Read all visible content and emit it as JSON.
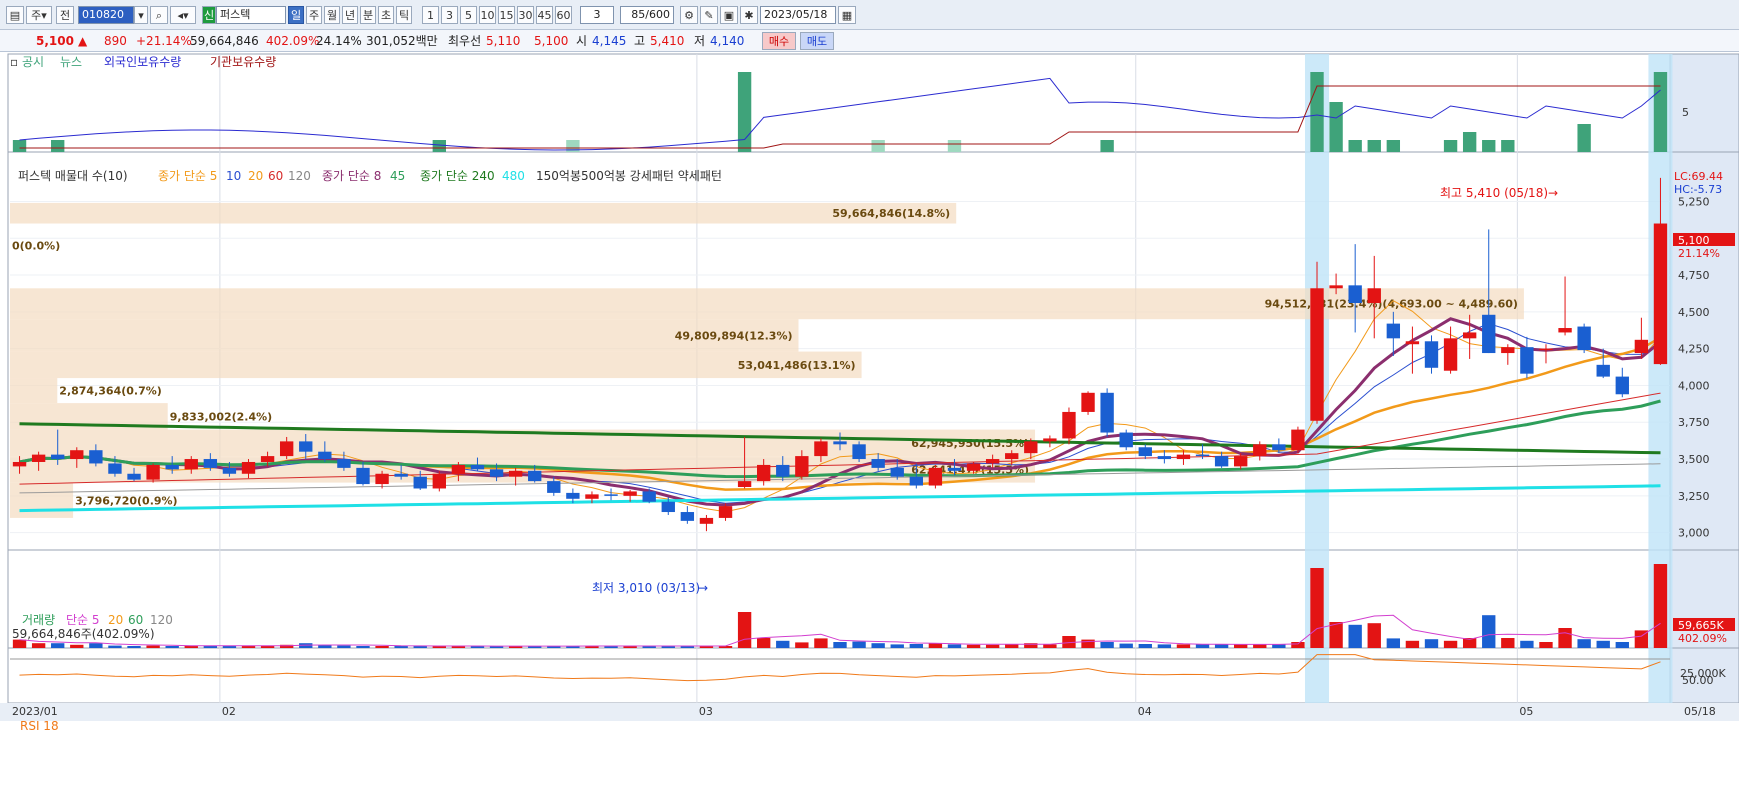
{
  "toolbar": {
    "period_btn": "주",
    "prev_btn": "전",
    "code": "010820",
    "stock_name": "퍼스텍",
    "new_badge": "신",
    "timeframes": [
      "일",
      "주",
      "월",
      "년",
      "분",
      "초",
      "틱"
    ],
    "numbers": [
      "1",
      "3",
      "5",
      "10",
      "15",
      "30",
      "45",
      "60"
    ],
    "select_val": "3",
    "count": "85/600",
    "date": "2023/05/18"
  },
  "quote": {
    "price": "5,100",
    "change": "890",
    "change_pct": "+21.14%",
    "volume": "59,664,846",
    "vol_ratio": "402.09%",
    "turnover": "24.14%",
    "amount": "301,052백만",
    "best_label": "최우선",
    "best_ask": "5,110",
    "best_bid": "5,100",
    "open_label": "시",
    "open": "4,145",
    "high_label": "고",
    "high": "5,410",
    "low_label": "저",
    "low": "4,140",
    "buy_btn": "매수",
    "sell_btn": "매도"
  },
  "panels": {
    "top_legend": [
      "공시",
      "뉴스",
      "외국인보유수량",
      "기관보유수량"
    ],
    "top_axis": "5",
    "price_legend": "퍼스텍 매물대 수(10)",
    "ma_group1": [
      "종가 단순 5",
      "10",
      "20",
      "60",
      "120"
    ],
    "ma_group2": [
      "종가 단순 8",
      "45"
    ],
    "ma_group3": [
      "종가 단순 240",
      "480"
    ],
    "pattern_legend": "150억봉500억봉 강세패턴  약세패턴",
    "lc": "LC:69.44",
    "hc": "HC:-5.73",
    "cur_price_tag": "5,100",
    "cur_pct_tag": "21.14%",
    "high_note": "최고 5,410 (05/18)",
    "low_note": "최저 3,010 (03/13)",
    "vol_legend": [
      "거래량",
      "단순 5",
      "20",
      "60",
      "120"
    ],
    "vol_value": "59,664,846주(402.09%)",
    "vol_tag": "59,665K",
    "vol_pct_tag": "402.09%",
    "vol_axis": "25,000K",
    "rsi_legend": "RSI 18",
    "rsi_axis": "50.00",
    "profile_labels": [
      "59,664,846(14.8%)",
      "0(0.0%)",
      "94,512,831(23.4%)(4,693.00 ~ 4,489.60)",
      "49,809,894(12.3%)",
      "53,041,486(13.1%)",
      "2,874,364(0.7%)",
      "9,833,002(2.4%)",
      "62,945,950(15.5%)",
      "62,641,477(15.5%)",
      "3,796,720(0.9%)"
    ],
    "date_axis": [
      "2023/01",
      "02",
      "03",
      "04",
      "05",
      "05/18"
    ]
  },
  "chart_data": {
    "type": "candlestick",
    "y_ticks": [
      3000,
      3250,
      3500,
      3750,
      4000,
      4250,
      4500,
      4750,
      5000,
      5250
    ],
    "candles": [
      [
        3450,
        3520,
        3400,
        3480
      ],
      [
        3480,
        3550,
        3420,
        3530
      ],
      [
        3530,
        3700,
        3460,
        3500
      ],
      [
        3500,
        3580,
        3440,
        3560
      ],
      [
        3560,
        3600,
        3450,
        3470
      ],
      [
        3470,
        3520,
        3380,
        3400
      ],
      [
        3400,
        3440,
        3350,
        3360
      ],
      [
        3360,
        3470,
        3340,
        3460
      ],
      [
        3460,
        3520,
        3400,
        3430
      ],
      [
        3430,
        3520,
        3400,
        3500
      ],
      [
        3500,
        3540,
        3420,
        3440
      ],
      [
        3440,
        3480,
        3380,
        3400
      ],
      [
        3400,
        3500,
        3370,
        3480
      ],
      [
        3480,
        3550,
        3450,
        3520
      ],
      [
        3520,
        3650,
        3500,
        3620
      ],
      [
        3620,
        3670,
        3500,
        3550
      ],
      [
        3550,
        3620,
        3480,
        3500
      ],
      [
        3500,
        3550,
        3420,
        3440
      ],
      [
        3440,
        3480,
        3320,
        3330
      ],
      [
        3330,
        3420,
        3300,
        3400
      ],
      [
        3400,
        3460,
        3360,
        3380
      ],
      [
        3380,
        3420,
        3290,
        3300
      ],
      [
        3300,
        3420,
        3280,
        3400
      ],
      [
        3400,
        3480,
        3350,
        3460
      ],
      [
        3460,
        3510,
        3420,
        3430
      ],
      [
        3430,
        3470,
        3350,
        3380
      ],
      [
        3380,
        3440,
        3320,
        3420
      ],
      [
        3420,
        3460,
        3340,
        3350
      ],
      [
        3350,
        3380,
        3250,
        3270
      ],
      [
        3270,
        3300,
        3200,
        3230
      ],
      [
        3230,
        3280,
        3200,
        3260
      ],
      [
        3260,
        3300,
        3220,
        3250
      ],
      [
        3250,
        3290,
        3210,
        3280
      ],
      [
        3280,
        3300,
        3200,
        3210
      ],
      [
        3210,
        3240,
        3120,
        3140
      ],
      [
        3140,
        3180,
        3060,
        3080
      ],
      [
        3060,
        3120,
        3010,
        3100
      ],
      [
        3100,
        3200,
        3080,
        3180
      ],
      [
        3310,
        3650,
        3300,
        3350
      ],
      [
        3350,
        3500,
        3320,
        3460
      ],
      [
        3460,
        3520,
        3350,
        3380
      ],
      [
        3380,
        3560,
        3360,
        3520
      ],
      [
        3520,
        3640,
        3480,
        3620
      ],
      [
        3620,
        3680,
        3560,
        3600
      ],
      [
        3600,
        3620,
        3480,
        3500
      ],
      [
        3500,
        3540,
        3420,
        3440
      ],
      [
        3440,
        3500,
        3360,
        3380
      ],
      [
        3380,
        3470,
        3300,
        3320
      ],
      [
        3320,
        3460,
        3300,
        3440
      ],
      [
        3440,
        3500,
        3390,
        3420
      ],
      [
        3420,
        3480,
        3400,
        3470
      ],
      [
        3470,
        3530,
        3440,
        3500
      ],
      [
        3500,
        3560,
        3460,
        3540
      ],
      [
        3540,
        3640,
        3500,
        3620
      ],
      [
        3620,
        3660,
        3580,
        3640
      ],
      [
        3640,
        3850,
        3600,
        3820
      ],
      [
        3820,
        3960,
        3800,
        3950
      ],
      [
        3950,
        3980,
        3650,
        3680
      ],
      [
        3680,
        3700,
        3560,
        3580
      ],
      [
        3580,
        3600,
        3500,
        3520
      ],
      [
        3520,
        3560,
        3470,
        3500
      ],
      [
        3500,
        3560,
        3460,
        3530
      ],
      [
        3530,
        3600,
        3500,
        3520
      ],
      [
        3520,
        3550,
        3440,
        3450
      ],
      [
        3450,
        3540,
        3430,
        3520
      ],
      [
        3520,
        3620,
        3490,
        3600
      ],
      [
        3600,
        3640,
        3540,
        3560
      ],
      [
        3560,
        3720,
        3540,
        3700
      ],
      [
        3760,
        4840,
        3740,
        4660
      ],
      [
        4660,
        4760,
        4620,
        4680
      ],
      [
        4680,
        4960,
        4360,
        4560
      ],
      [
        4560,
        4880,
        4320,
        4660
      ],
      [
        4420,
        4500,
        4200,
        4320
      ],
      [
        4280,
        4400,
        4080,
        4300
      ],
      [
        4300,
        4340,
        4080,
        4120
      ],
      [
        4100,
        4400,
        4080,
        4320
      ],
      [
        4320,
        4480,
        4180,
        4360
      ],
      [
        4480,
        5060,
        4220,
        4220
      ],
      [
        4220,
        4280,
        4140,
        4260
      ],
      [
        4260,
        4330,
        4050,
        4080
      ],
      [
        4240,
        4280,
        4150,
        4250
      ],
      [
        4360,
        4740,
        4340,
        4390
      ],
      [
        4400,
        4420,
        4220,
        4240
      ],
      [
        4140,
        4250,
        4050,
        4060
      ],
      [
        4060,
        4120,
        3920,
        3940
      ],
      [
        4220,
        4460,
        4180,
        4310
      ],
      [
        4145,
        5410,
        4140,
        5100
      ]
    ],
    "ma5_end": 4214,
    "ma20_end": 4280,
    "ma240_end": 3550,
    "volume_k": [
      2100,
      1200,
      1200,
      800,
      1200,
      600,
      500,
      600,
      500,
      600,
      500,
      500,
      600,
      500,
      800,
      1200,
      700,
      600,
      500,
      500,
      500,
      500,
      500,
      500,
      500,
      400,
      500,
      500,
      500,
      500,
      500,
      500,
      500,
      500,
      500,
      500,
      500,
      500,
      9000,
      2500,
      1800,
      1400,
      2400,
      1500,
      1600,
      1200,
      900,
      1000,
      1200,
      900,
      800,
      800,
      900,
      1200,
      900,
      3000,
      2100,
      1500,
      1100,
      1000,
      900,
      900,
      900,
      900,
      900,
      900,
      900,
      1500,
      20000,
      6500,
      5800,
      6200,
      2400,
      1800,
      2200,
      1800,
      2500,
      8200,
      2500,
      1800,
      1500,
      5000,
      2200,
      1800,
      1500,
      4400,
      21000
    ],
    "rsi_label": "RSI 18"
  }
}
